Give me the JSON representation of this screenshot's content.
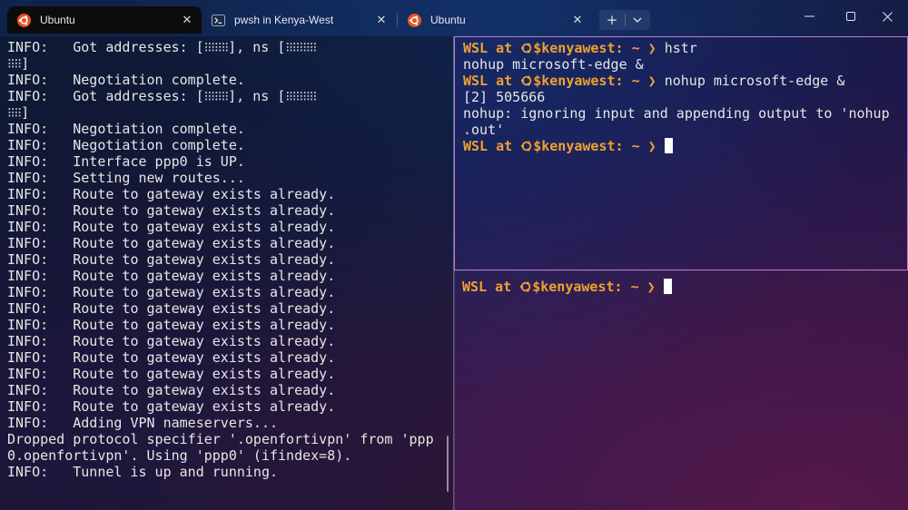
{
  "colors": {
    "prompt": "#f0a030",
    "text": "#e6e6e6",
    "pane_focus_border": "#b980c8",
    "active_tab_bg": "#0c0c0c",
    "ubuntu_orange": "#e95420"
  },
  "tabs": [
    {
      "label": "Ubuntu",
      "icon": "ubuntu-icon",
      "active": true
    },
    {
      "label": "pwsh in Kenya-West",
      "icon": "powershell-icon",
      "active": false
    },
    {
      "label": "Ubuntu",
      "icon": "ubuntu-icon",
      "active": false
    }
  ],
  "titlebar": {
    "new_tab": "+",
    "dropdown": "⌄",
    "minimize": "—",
    "maximize": "☐",
    "close": "✕"
  },
  "prompt": {
    "wsl": "WSL",
    "at": "at",
    "host": "$kenyawest",
    "sep": ":",
    "tilde": "~",
    "arrow": "❯"
  },
  "left_pane": {
    "lines": [
      [
        "INFO:   Got addresses: [",
        "⁝⁝⁝⁝⁝⁝⁝",
        "], ns [",
        "⁝⁝⁝⁝⁝⁝⁝⁝⁝",
        ""
      ],
      [
        "",
        "⁝⁝⁝⁝",
        "]",
        "",
        ""
      ],
      [
        "INFO:   Negotiation complete.",
        "",
        "",
        "",
        ""
      ],
      [
        "INFO:   Got addresses: [",
        "⁝⁝⁝⁝⁝⁝⁝",
        "], ns [",
        "⁝⁝⁝⁝⁝⁝⁝⁝⁝",
        ""
      ],
      [
        "",
        "⁝⁝⁝⁝",
        "]",
        "",
        ""
      ],
      [
        "INFO:   Negotiation complete.",
        "",
        "",
        "",
        ""
      ],
      [
        "INFO:   Negotiation complete.",
        "",
        "",
        "",
        ""
      ],
      [
        "INFO:   Interface ppp0 is UP.",
        "",
        "",
        "",
        ""
      ],
      [
        "INFO:   Setting new routes...",
        "",
        "",
        "",
        ""
      ],
      [
        "INFO:   Route to gateway exists already.",
        "",
        "",
        "",
        ""
      ],
      [
        "INFO:   Route to gateway exists already.",
        "",
        "",
        "",
        ""
      ],
      [
        "INFO:   Route to gateway exists already.",
        "",
        "",
        "",
        ""
      ],
      [
        "INFO:   Route to gateway exists already.",
        "",
        "",
        "",
        ""
      ],
      [
        "INFO:   Route to gateway exists already.",
        "",
        "",
        "",
        ""
      ],
      [
        "INFO:   Route to gateway exists already.",
        "",
        "",
        "",
        ""
      ],
      [
        "INFO:   Route to gateway exists already.",
        "",
        "",
        "",
        ""
      ],
      [
        "INFO:   Route to gateway exists already.",
        "",
        "",
        "",
        ""
      ],
      [
        "INFO:   Route to gateway exists already.",
        "",
        "",
        "",
        ""
      ],
      [
        "INFO:   Route to gateway exists already.",
        "",
        "",
        "",
        ""
      ],
      [
        "INFO:   Route to gateway exists already.",
        "",
        "",
        "",
        ""
      ],
      [
        "INFO:   Route to gateway exists already.",
        "",
        "",
        "",
        ""
      ],
      [
        "INFO:   Route to gateway exists already.",
        "",
        "",
        "",
        ""
      ],
      [
        "INFO:   Route to gateway exists already.",
        "",
        "",
        "",
        ""
      ],
      [
        "INFO:   Adding VPN nameservers...",
        "",
        "",
        "",
        ""
      ],
      [
        "Dropped protocol specifier '.openfortivpn' from 'ppp",
        "",
        "",
        "",
        ""
      ],
      [
        "0.openfortivpn'. Using 'ppp0' (ifindex=8).",
        "",
        "",
        "",
        ""
      ],
      [
        "INFO:   Tunnel is up and running.",
        "",
        "",
        "",
        ""
      ]
    ]
  },
  "right_top": {
    "cmd1": "hstr",
    "out1": "nohup microsoft-edge &",
    "cmd2": "nohup microsoft-edge &",
    "out2": "[2] 505666",
    "out3": "nohup: ignoring input and appending output to 'nohup",
    "out4": ".out'"
  }
}
